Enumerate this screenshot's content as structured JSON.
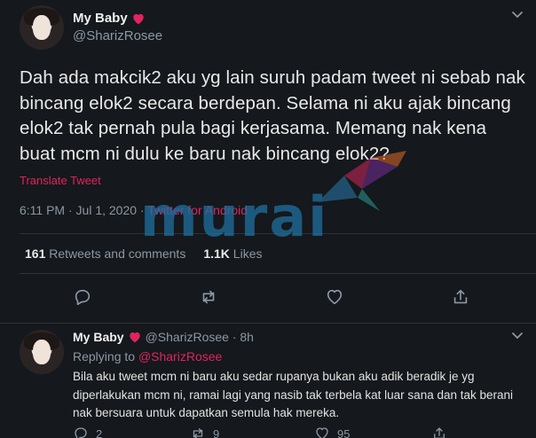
{
  "main_tweet": {
    "display_name": "My Baby",
    "handle": "@SharizRosee",
    "text": "Dah ada makcik2 aku yg lain suruh padam tweet ni sebab nak bincang elok2 secara berdepan. Selama ni aku ajak bincang elok2 tak pernah pula bagi kerjasama. Memang nak kena buat mcm ni dulu ke baru nak bincang elok2?",
    "translate_label": "Translate Tweet",
    "timestamp": "6:11 PM · Jul 1, 2020 · ",
    "source": "Twitter for Android",
    "retweets_count": "161",
    "retweets_label": "Retweets and comments",
    "likes_count": "1.1K",
    "likes_label": "Likes"
  },
  "reply_tweet": {
    "display_name": "My Baby",
    "handle_time": "@SharizRosee · 8h",
    "replying_prefix": "Replying to ",
    "replying_to": "@SharizRosee",
    "text": "Bila aku tweet mcm ni baru aku sedar rupanya bukan aku adik beradik je yg diperlakukan mcm ni, ramai lagi yang nasib tak terbela kat luar sana dan tak berani nak bersuara untuk dapatkan semula hak mereka.",
    "reply_count": "2",
    "retweet_count": "9",
    "like_count": "95"
  },
  "watermark": {
    "text": "murai"
  },
  "colors": {
    "accent": "#e0245e",
    "background": "#15181c",
    "muted": "#8b98a5",
    "divider": "#2f3336"
  },
  "icons": [
    "heart-icon",
    "chevron-down-icon",
    "reply-icon",
    "retweet-icon",
    "like-icon",
    "share-icon"
  ]
}
